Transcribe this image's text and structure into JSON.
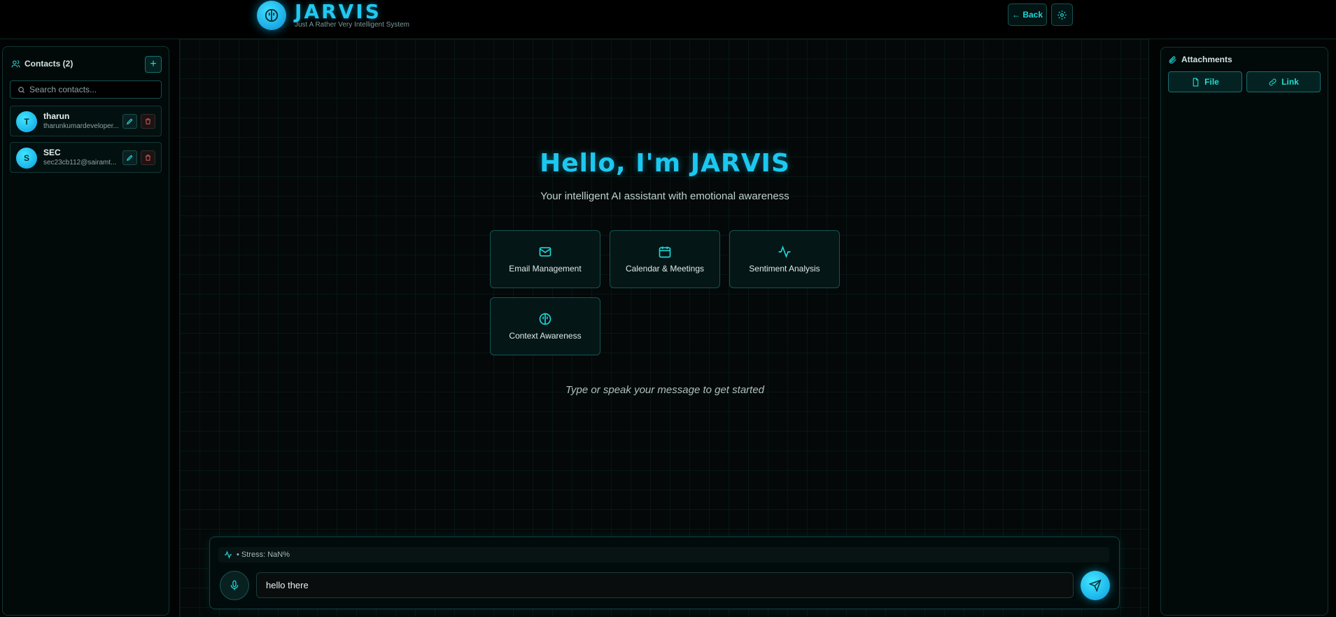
{
  "header": {
    "title": "JARVIS",
    "subtitle": "Just A Rather Very Intelligent System",
    "back_label": "← Back",
    "logo_icon": "brain-icon",
    "settings_icon": "gear-icon"
  },
  "sidebar": {
    "title": "Contacts (2)",
    "add_label": "+",
    "search_placeholder": "Search contacts...",
    "contacts": [
      {
        "initial": "T",
        "name": "tharun",
        "email": "tharunkumardeveloper..."
      },
      {
        "initial": "S",
        "name": "SEC",
        "email": "sec23cb112@sairamt..."
      }
    ]
  },
  "main": {
    "greeting": "Hello, I'm JARVIS",
    "tagline": "Your intelligent AI assistant with emotional awareness",
    "features": [
      {
        "label": "Email Management",
        "icon": "mail-icon"
      },
      {
        "label": "Calendar & Meetings",
        "icon": "calendar-icon"
      },
      {
        "label": "Sentiment Analysis",
        "icon": "activity-icon"
      },
      {
        "label": "Context Awareness",
        "icon": "brain-icon"
      }
    ],
    "hint": "Type or speak your message to get started"
  },
  "composer": {
    "stress_text": "• Stress: NaN%",
    "message_value": "hello there"
  },
  "attachments": {
    "title": "Attachments",
    "file_label": "File",
    "link_label": "Link"
  },
  "colors": {
    "accent": "#1fd6d6",
    "brand": "#21c9f0",
    "background": "#020404",
    "danger": "#c0504a"
  }
}
